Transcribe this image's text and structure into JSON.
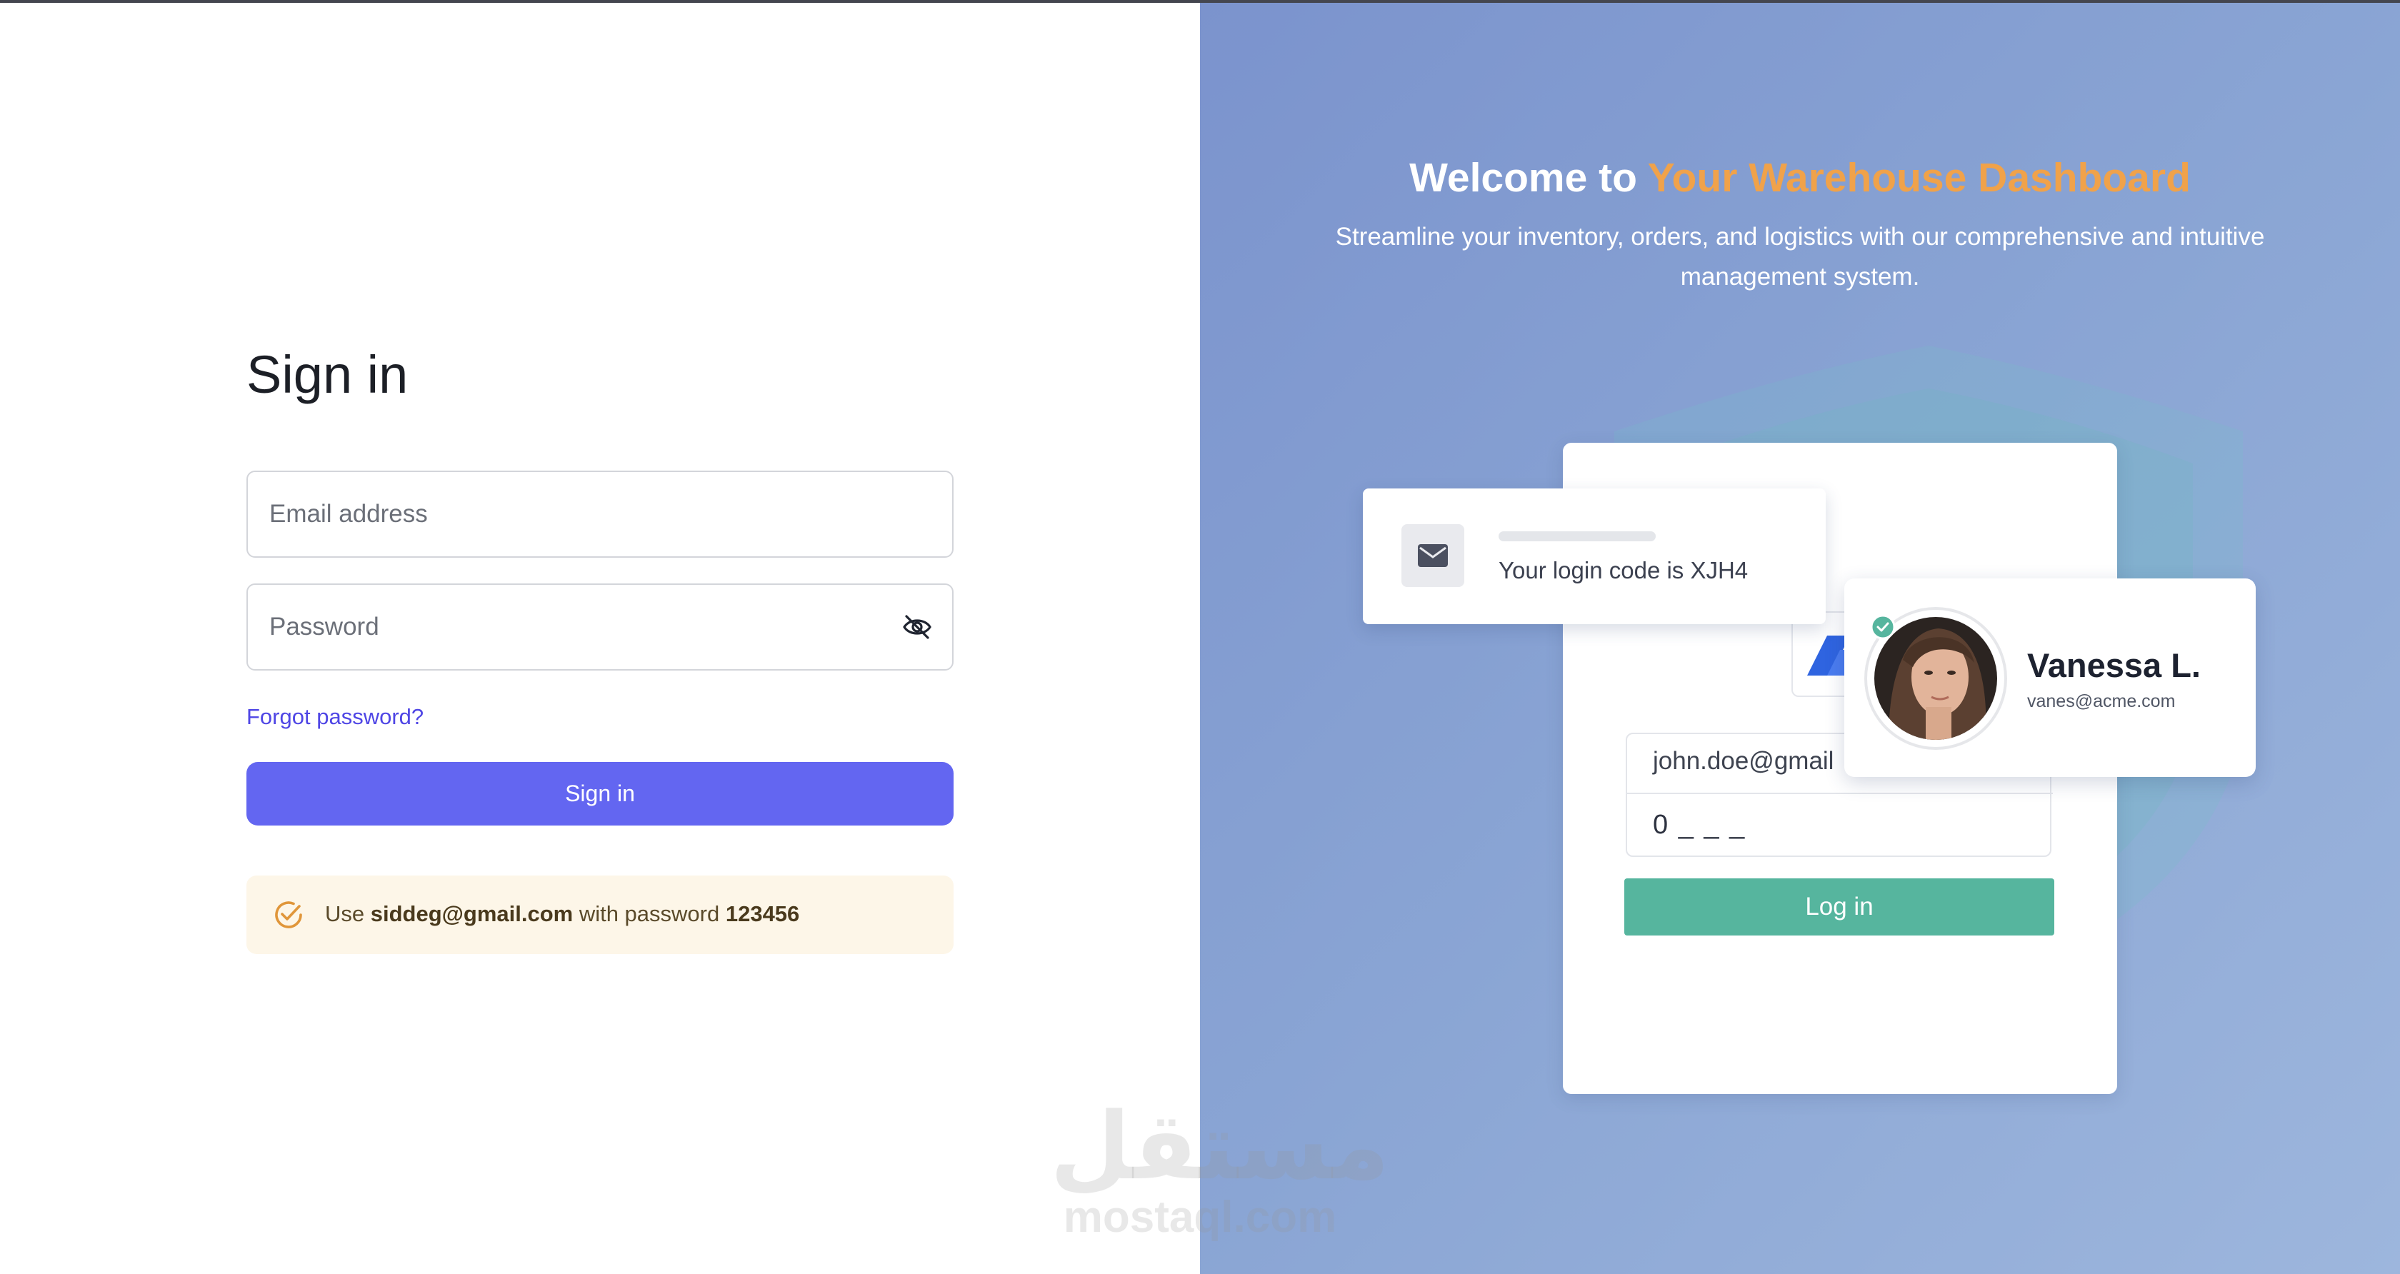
{
  "signin": {
    "title": "Sign in",
    "email_placeholder": "Email address",
    "password_placeholder": "Password",
    "forgot_label": "Forgot password?",
    "button_label": "Sign in",
    "hint": {
      "prefix": "Use ",
      "email": "siddeg@gmail.com",
      "middle": " with password ",
      "password": "123456"
    }
  },
  "promo": {
    "headline_prefix": "Welcome to ",
    "headline_highlight": "Your Warehouse Dashboard",
    "subline": "Streamline your inventory, orders, and logistics with our comprehensive and intuitive management system.",
    "mockup": {
      "notification_text": "Your login code is XJH4",
      "email_value": "john.doe@gmail",
      "code_value": "0 _ _ _",
      "login_label": "Log in",
      "profile_name": "Vanessa L.",
      "profile_email": "vanes@acme.com"
    }
  },
  "watermark": {
    "arabic": "مستقل",
    "latin": "mostaql.com"
  },
  "colors": {
    "primary": "#6366f1",
    "link": "#4f46e5",
    "highlight": "#f0a24a",
    "login_green": "#56b59e",
    "hint_bg": "#fdf6e8"
  },
  "icons": [
    "eye-off-icon",
    "check-circle-icon",
    "mail-icon",
    "verified-check-icon",
    "brand-logo-icon"
  ]
}
